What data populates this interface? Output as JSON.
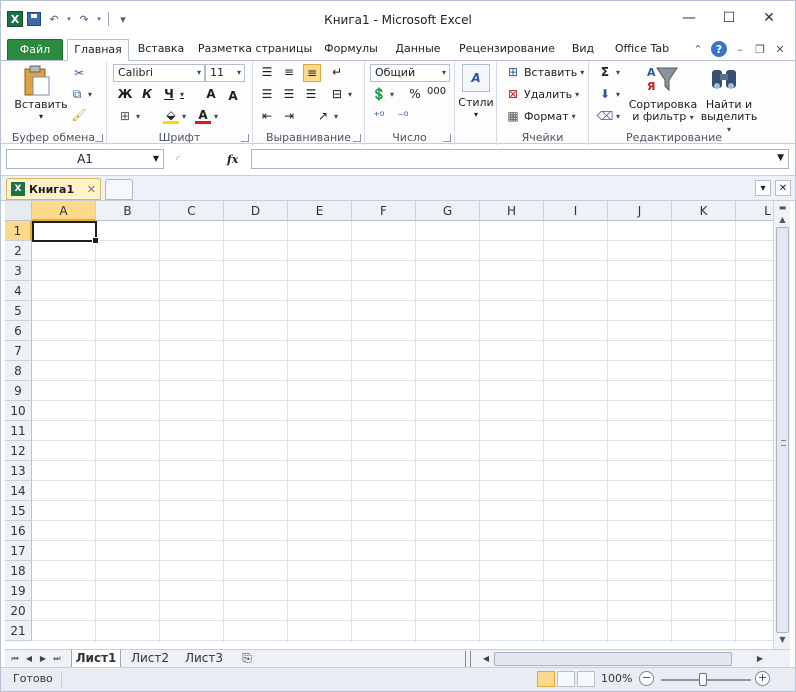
{
  "window": {
    "title": "Книга1  -  Microsoft Excel",
    "controls": {
      "minimize": "—",
      "maximize": "☐",
      "close": "✕"
    }
  },
  "qat": {
    "app_icon": "X",
    "save_icon": "save-icon",
    "undo": "↶",
    "redo": "↷",
    "customize": "▾"
  },
  "tabs": {
    "file": "Файл",
    "items": [
      {
        "label": "Главная"
      },
      {
        "label": "Вставка"
      },
      {
        "label": "Разметка страницы"
      },
      {
        "label": "Формулы"
      },
      {
        "label": "Данные"
      },
      {
        "label": "Рецензирование"
      },
      {
        "label": "Вид"
      },
      {
        "label": "Office Tab"
      }
    ],
    "help": "?"
  },
  "ribbon": {
    "clipboard": {
      "label": "Буфер обмена",
      "paste": "Вставить"
    },
    "font": {
      "label": "Шрифт",
      "name": "Calibri",
      "size": "11",
      "bold": "Ж",
      "italic": "К",
      "underline": "Ч",
      "grow": "A",
      "shrink": "A"
    },
    "alignment": {
      "label": "Выравнивание"
    },
    "number": {
      "label": "Число",
      "format": "Общий",
      "percent": "%",
      "thousands": "000"
    },
    "styles": {
      "label": "Стили"
    },
    "cells": {
      "label": "Ячейки",
      "insert": "Вставить",
      "delete": "Удалить",
      "format": "Формат"
    },
    "editing": {
      "label": "Редактирование",
      "sort_line1": "Сортировка",
      "sort_line2": "и фильтр",
      "find_line1": "Найти и",
      "find_line2": "выделить",
      "sum": "Σ"
    }
  },
  "formula_bar": {
    "name_box": "A1",
    "fx": "fx",
    "value": ""
  },
  "doc_tabs": {
    "active": "Книга1"
  },
  "grid": {
    "columns": [
      "A",
      "B",
      "C",
      "D",
      "E",
      "F",
      "G",
      "H",
      "I",
      "J",
      "K",
      "L"
    ],
    "rows": [
      "1",
      "2",
      "3",
      "4",
      "5",
      "6",
      "7",
      "8",
      "9",
      "10",
      "11",
      "12",
      "13",
      "14",
      "15",
      "16",
      "17",
      "18",
      "19",
      "20",
      "21"
    ],
    "selected_cell": "A1"
  },
  "sheets": [
    {
      "label": "Лист1"
    },
    {
      "label": "Лист2"
    },
    {
      "label": "Лист3"
    }
  ],
  "status": {
    "ready": "Готово",
    "zoom": "100%",
    "zoom_minus": "−",
    "zoom_plus": "+"
  }
}
